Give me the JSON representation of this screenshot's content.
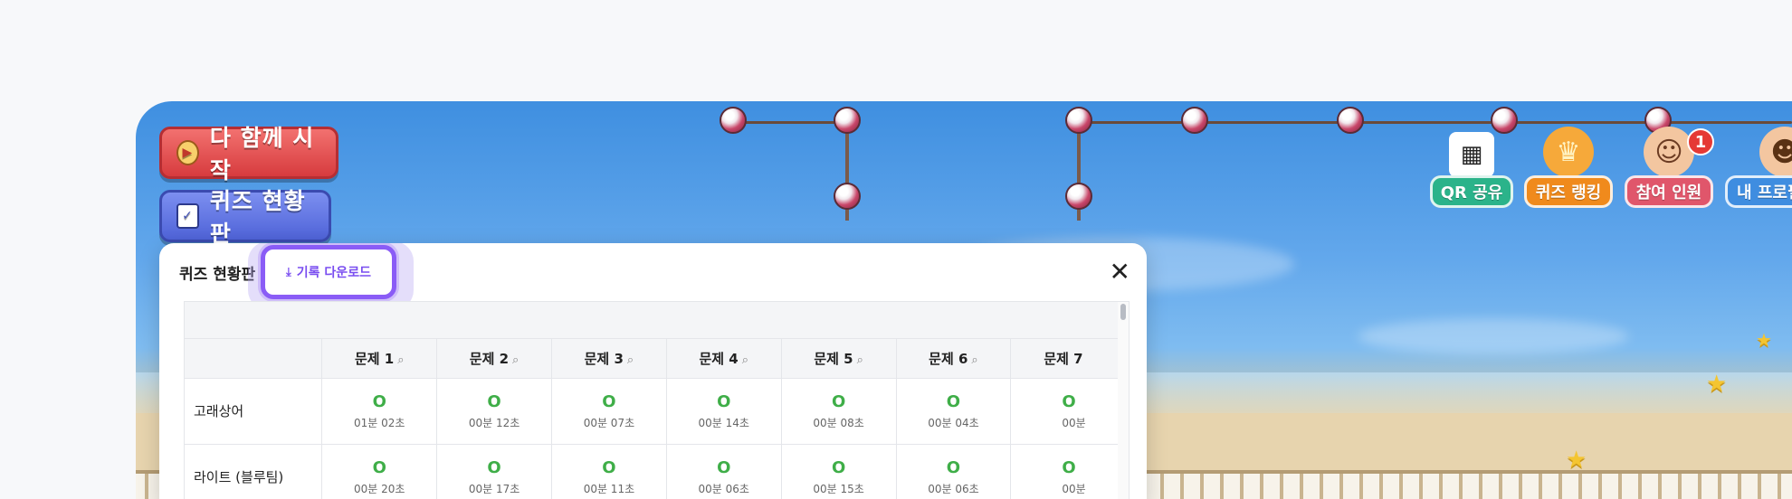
{
  "buttons": {
    "start_all": "다 함께 시작",
    "quiz_board": "퀴즈 현황판"
  },
  "top_menu": [
    {
      "label": "QR 공유",
      "icon": "qr-code-icon",
      "color": "#2bb38a"
    },
    {
      "label": "퀴즈 랭킹",
      "icon": "trophy-icon",
      "color": "#f08a1c"
    },
    {
      "label": "참여 인원",
      "icon": "participants-icon",
      "color": "#e0566b",
      "badge": "1"
    },
    {
      "label": "내 프로필",
      "icon": "profile-icon",
      "color": "#3f8de0"
    }
  ],
  "panel": {
    "title": "퀴즈 현황판",
    "download_label": "기록 다운로드"
  },
  "table": {
    "columns": [
      "문제 1",
      "문제 2",
      "문제 3",
      "문제 4",
      "문제 5",
      "문제 6",
      "문제 7"
    ],
    "rows": [
      {
        "name": "고래상어",
        "cells": [
          {
            "mark": "O",
            "time": "01분 02초"
          },
          {
            "mark": "O",
            "time": "00분 12초"
          },
          {
            "mark": "O",
            "time": "00분 07초"
          },
          {
            "mark": "O",
            "time": "00분 14초"
          },
          {
            "mark": "O",
            "time": "00분 08초"
          },
          {
            "mark": "O",
            "time": "00분 04초"
          },
          {
            "mark": "O",
            "time": "00분"
          }
        ]
      },
      {
        "name": "라이트 (블루팀)",
        "cells": [
          {
            "mark": "O",
            "time": "00분 20초"
          },
          {
            "mark": "O",
            "time": "00분 17초"
          },
          {
            "mark": "O",
            "time": "00분 11초"
          },
          {
            "mark": "O",
            "time": "00분 06초"
          },
          {
            "mark": "O",
            "time": "00분 15초"
          },
          {
            "mark": "O",
            "time": "00분 06초"
          },
          {
            "mark": "O",
            "time": "00분"
          }
        ]
      }
    ]
  }
}
